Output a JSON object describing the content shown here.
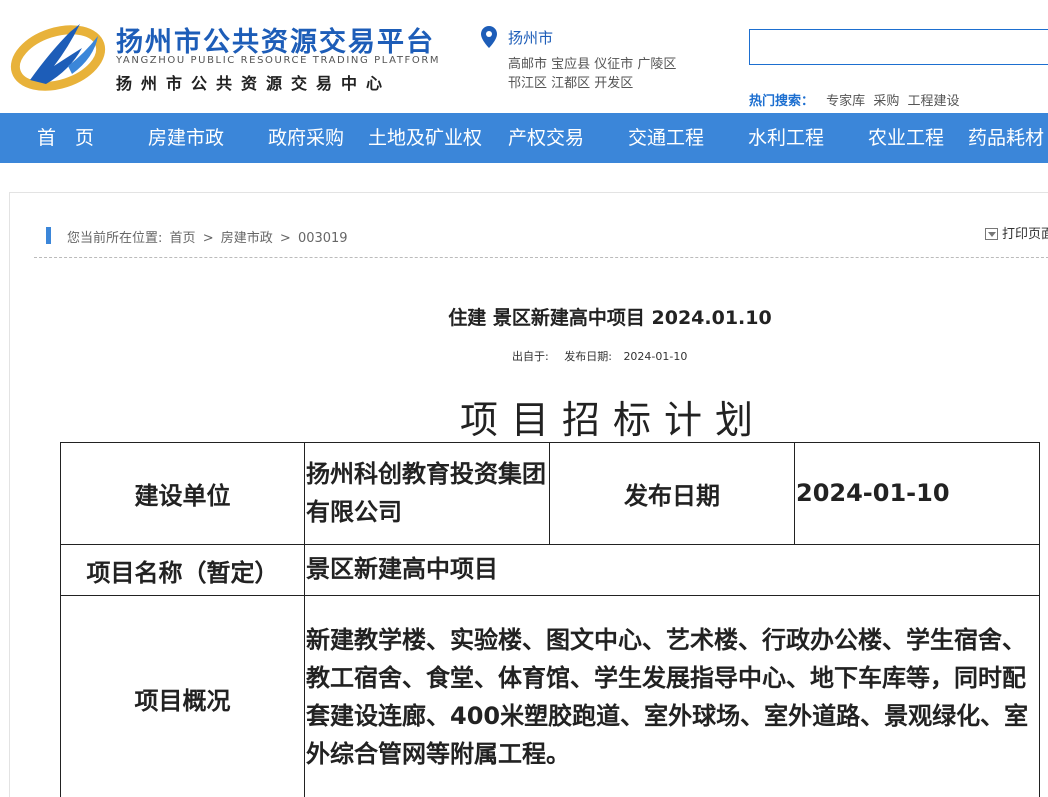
{
  "site": {
    "name_cn": "扬州市公共资源交易平台",
    "name_en": "YANGZHOU PUBLIC RESOURCE TRADING PLATFORM",
    "center_cn": "扬州市公共资源交易中心"
  },
  "location": {
    "city": "扬州市",
    "districts_line1": "高邮市 宝应县 仪征市 广陵区",
    "districts_line2": "邗江区 江都区 开发区"
  },
  "search": {
    "value": "",
    "placeholder": "",
    "hot_label": "热门搜索：",
    "hot_links": [
      "专家库",
      "采购",
      "工程建设"
    ]
  },
  "colors": {
    "brand_blue": "#1d5db8",
    "nav_blue": "#3b86d9"
  },
  "nav": {
    "items": [
      "首　页",
      "房建市政",
      "政府采购",
      "土地及矿业权",
      "产权交易",
      "交通工程",
      "水利工程",
      "农业工程",
      "药品耗材"
    ]
  },
  "breadcrumb": {
    "prefix": "您当前所在位置:",
    "items": [
      "首页",
      ">",
      "房建市政",
      ">",
      "003019"
    ]
  },
  "toolbar": {
    "print_label": "打印页面",
    "print_icon": "printer-icon"
  },
  "article": {
    "title": "住建 景区新建高中项目 2024.01.10",
    "source_label": "出自于:",
    "date_label": "发布日期:",
    "date": "2024-01-10"
  },
  "document": {
    "heading": "项目招标计划",
    "rows": [
      {
        "label": "建设单位",
        "value": "扬州科创教育投资集团有限公司",
        "label2": "发布日期",
        "value2": "2024-01-10"
      },
      {
        "label": "项目名称（暂定）",
        "value": "景区新建高中项目"
      },
      {
        "label": "项目概况",
        "value": "新建教学楼、实验楼、图文中心、艺术楼、行政办公楼、学生宿舍、教工宿舍、食堂、体育馆、学生发展指导中心、地下车库等，同时配套建设连廊、400米塑胶跑道、室外球场、室外道路、景观绿化、室外综合管网等附属工程。"
      }
    ]
  }
}
